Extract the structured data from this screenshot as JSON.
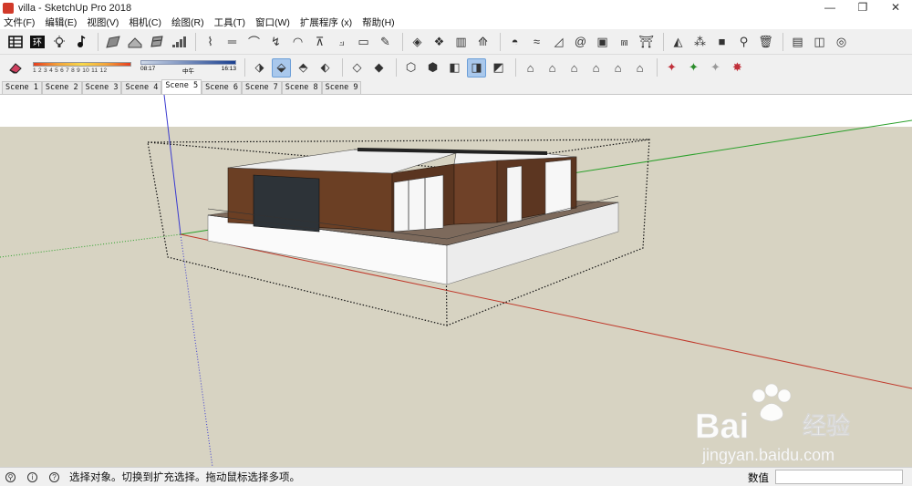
{
  "window": {
    "title": "villa - SketchUp Pro 2018",
    "controls": {
      "minimize": "—",
      "maximize": "❐",
      "close": "✕"
    }
  },
  "menu": {
    "items": [
      {
        "label": "文件(F)"
      },
      {
        "label": "编辑(E)"
      },
      {
        "label": "视图(V)"
      },
      {
        "label": "相机(C)"
      },
      {
        "label": "绘图(R)"
      },
      {
        "label": "工具(T)"
      },
      {
        "label": "窗口(W)"
      },
      {
        "label": "扩展程序 (x)"
      },
      {
        "label": "帮助(H)"
      }
    ]
  },
  "shadow": {
    "months": "1 2 3 4 5 6 7 8 9 10 11 12",
    "time_start": "08:17",
    "time_mid": "中午",
    "time_end": "16:13"
  },
  "scenes": [
    {
      "label": "Scene 1"
    },
    {
      "label": "Scene 2"
    },
    {
      "label": "Scene 3"
    },
    {
      "label": "Scene 4"
    },
    {
      "label": "Scene 5",
      "active": true
    },
    {
      "label": "Scene 6"
    },
    {
      "label": "Scene 7"
    },
    {
      "label": "Scene 8"
    },
    {
      "label": "Scene 9"
    }
  ],
  "status": {
    "hint": "选择对象。切换到扩充选择。拖动鼠标选择多项。",
    "measurements_label": "数值",
    "measurements_value": ""
  },
  "watermark": {
    "brand": "Bai",
    "brand_suffix": "经验",
    "url": "jingyan.baidu.com"
  },
  "colors": {
    "sky": "#ffffff",
    "ground": "#d7d3c2",
    "axis_red": "#c0392b",
    "axis_green": "#2aa02a",
    "axis_blue": "#3a3ad0",
    "wood": "#6b3f24"
  },
  "icons": {
    "toolbar1": [
      "select-icon",
      "eraser-icon",
      "paint-bucket-icon",
      "line-icon",
      "arc-icon",
      "rectangle-icon",
      "push-pull-icon",
      "move-icon",
      "rotate-icon",
      "scale-icon",
      "offset-icon",
      "tape-measure-icon",
      "dimension-icon",
      "protractor-icon",
      "text-icon",
      "axes-icon",
      "3d-text-icon",
      "orbit-icon",
      "pan-icon",
      "zoom-icon",
      "zoom-extents-icon",
      "walk-icon",
      "look-around-icon",
      "section-plane-icon",
      "warehouse-icon",
      "extension-warehouse-icon",
      "layout-icon",
      "ruby-icon"
    ],
    "toolbar2": [
      "eraser-icon",
      "iso-view-icon",
      "top-view-icon",
      "front-view-icon",
      "right-view-icon",
      "back-view-icon",
      "left-view-icon",
      "xray-icon",
      "wireframe-icon",
      "hidden-line-icon",
      "shaded-icon",
      "textured-icon",
      "monochrome-icon",
      "model-house-icon",
      "house-front-icon",
      "house-open-icon",
      "house-roof-icon",
      "house-outline-icon",
      "house-box-icon",
      "component-red-icon",
      "component-green-icon",
      "component-white-icon",
      "component-star-icon"
    ]
  }
}
